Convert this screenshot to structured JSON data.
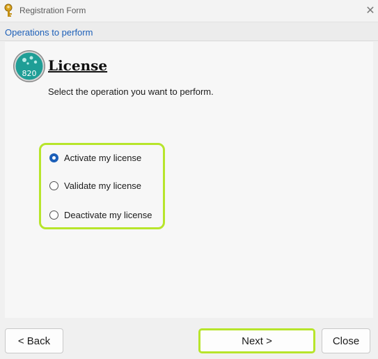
{
  "window": {
    "title": "Registration Form",
    "title_icon": "key-icon",
    "close_icon": "close-icon",
    "close_glyph": "✕"
  },
  "section": {
    "label": "Operations to perform"
  },
  "content": {
    "badge_icon": "license-badge-icon",
    "badge_text": "820",
    "heading": "License",
    "subtitle": "Select the operation you want to perform.",
    "options": [
      {
        "label": "Activate my license",
        "selected": true
      },
      {
        "label": "Validate my license",
        "selected": false
      },
      {
        "label": "Deactivate my license",
        "selected": false
      }
    ],
    "highlight_color": "#b7e52b",
    "accent_color": "#1c5fb8"
  },
  "footer": {
    "back_label": "< Back",
    "next_label": "Next >",
    "close_label": "Close"
  }
}
